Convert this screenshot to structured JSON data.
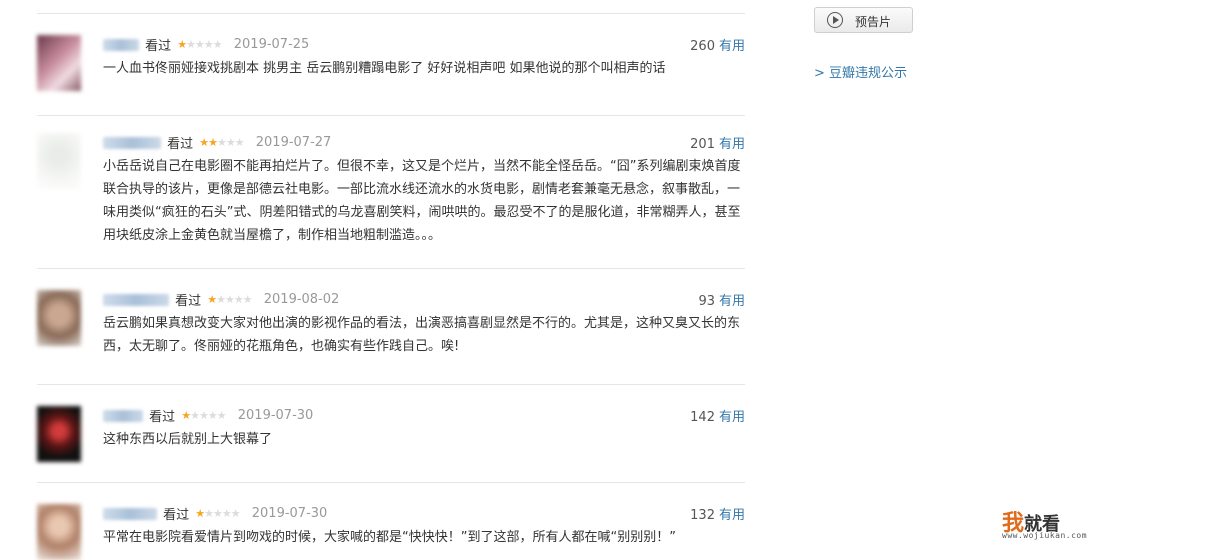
{
  "comments": [
    {
      "status": "看过",
      "rating": 1,
      "date": "2019-07-25",
      "votes": "260",
      "useful_label": "有用",
      "text": "一人血书佟丽娅接戏挑剧本 挑男主 岳云鹏别糟蹋电影了 好好说相声吧 如果他说的那个叫相声的话"
    },
    {
      "status": "看过",
      "rating": 2,
      "date": "2019-07-27",
      "votes": "201",
      "useful_label": "有用",
      "text": "小岳岳说自己在电影圈不能再拍烂片了。但很不幸，这又是个烂片，当然不能全怪岳岳。“囧”系列编剧束焕首度联合执导的该片，更像是部德云社电影。一部比流水线还流水的水货电影，剧情老套兼毫无悬念，叙事散乱，一味用类似“疯狂的石头”式、阴差阳错式的乌龙喜剧笑料，闹哄哄的。最忍受不了的是服化道，非常糊弄人，甚至用块纸皮涂上金黄色就当屋檐了，制作相当地粗制滥造。。。"
    },
    {
      "status": "看过",
      "rating": 1,
      "date": "2019-08-02",
      "votes": "93",
      "useful_label": "有用",
      "text": "岳云鹏如果真想改变大家对他出演的影视作品的看法，出演恶搞喜剧显然是不行的。尤其是，这种又臭又长的东西，太无聊了。佟丽娅的花瓶角色，也确实有些作践自己。唉!"
    },
    {
      "status": "看过",
      "rating": 1,
      "date": "2019-07-30",
      "votes": "142",
      "useful_label": "有用",
      "text": "这种东西以后就别上大银幕了"
    },
    {
      "status": "看过",
      "rating": 1,
      "date": "2019-07-30",
      "votes": "132",
      "useful_label": "有用",
      "text": "平常在电影院看爱情片到吻戏的时候，大家喊的都是“快快快！”到了这部，所有人都在喊“别别别！”"
    }
  ],
  "sidebar": {
    "trailer_label": "预告片",
    "notice_link": "> 豆瓣违规公示"
  },
  "watermark": {
    "brand_wo": "我",
    "brand_rest": "就看",
    "url": "www.wojiukan.com"
  },
  "colors": {
    "link": "#3377aa",
    "star": "#f5a623",
    "date": "#999999"
  }
}
